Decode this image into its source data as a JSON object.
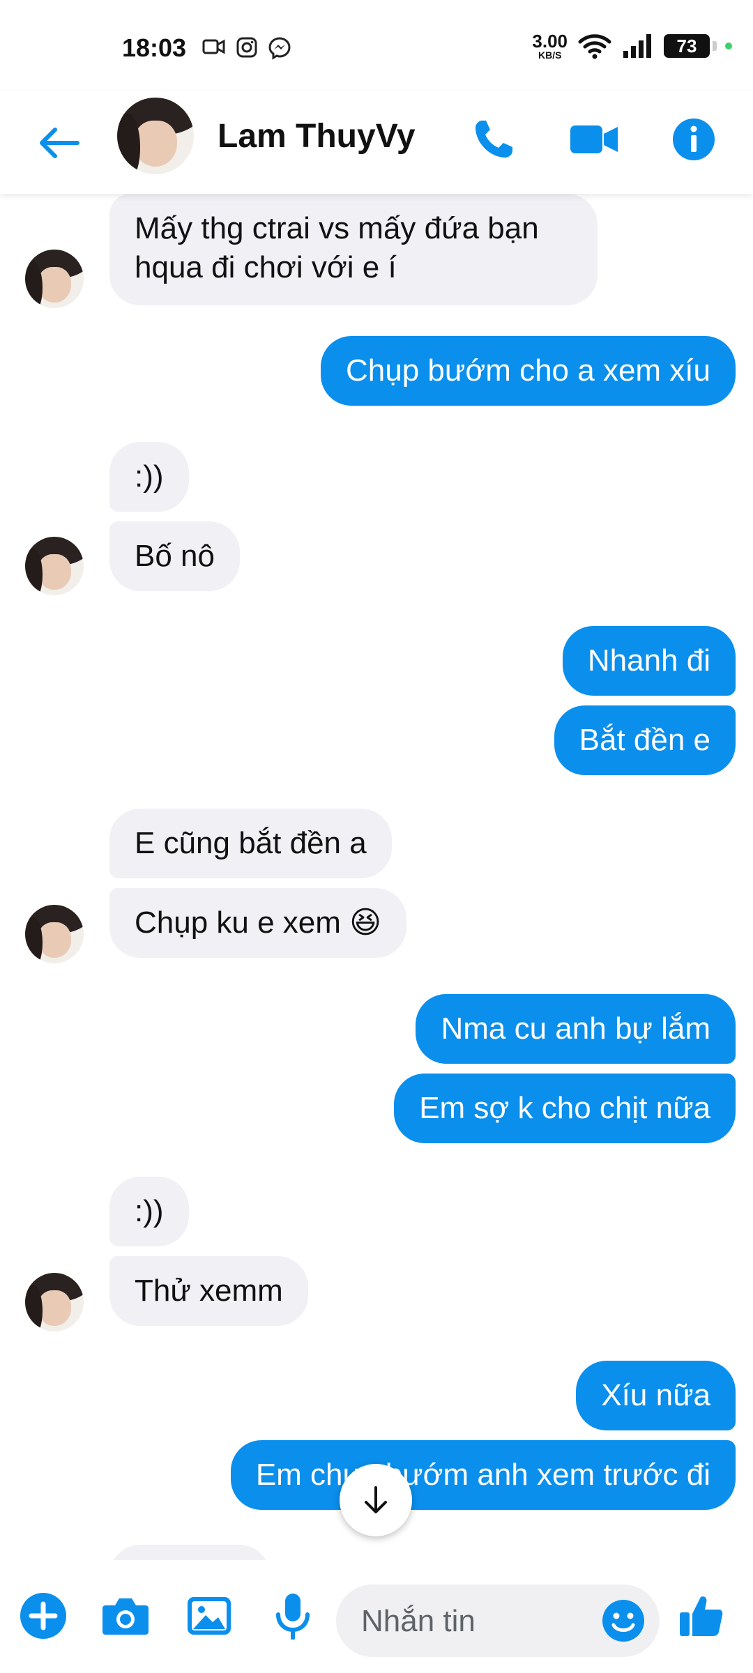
{
  "status_bar": {
    "time": "18:03",
    "net_speed": "3.00",
    "net_unit": "KB/S",
    "battery": "73"
  },
  "header": {
    "contact_name": "Lam ThuyVy",
    "accent_color": "#0a8fed"
  },
  "messages": [
    {
      "side": "in",
      "text": "Mấy thg ctrai vs mấy đứa bạn"
    },
    {
      "side": "in",
      "text": "hqua đi chơi với e í"
    },
    {
      "side": "out",
      "text": "Chụp bướm cho a  xem xíu"
    },
    {
      "side": "in",
      "text": ":))"
    },
    {
      "side": "in",
      "text": "Bố nô"
    },
    {
      "side": "out",
      "text": "Nhanh đi"
    },
    {
      "side": "out",
      "text": "Bắt đền e"
    },
    {
      "side": "in",
      "text": "E cũng bắt đền a"
    },
    {
      "side": "in",
      "text": "Chụp ku e xem 😆"
    },
    {
      "side": "out",
      "text": "Nma cu anh bự lắm"
    },
    {
      "side": "out",
      "text": "Em sợ k cho chịt nữa"
    },
    {
      "side": "in",
      "text": ":))"
    },
    {
      "side": "in",
      "text": "Thử xemm"
    },
    {
      "side": "out",
      "text": "Xíu nữa"
    },
    {
      "side": "out",
      "text": "Em chụp bướm anh xem trước đi"
    }
  ],
  "composer": {
    "placeholder": "Nhắn tin"
  }
}
